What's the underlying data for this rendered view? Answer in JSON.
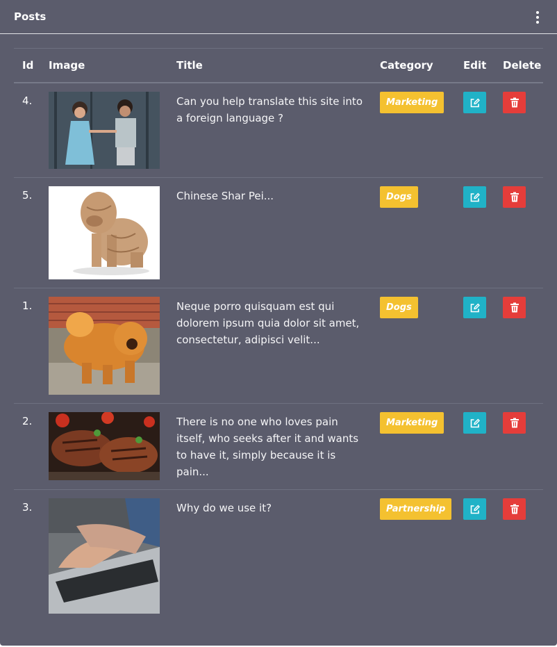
{
  "card": {
    "title": "Posts"
  },
  "table": {
    "headers": {
      "id": "Id",
      "image": "Image",
      "title": "Title",
      "category": "Category",
      "edit": "Edit",
      "delete": "Delete"
    },
    "rows": [
      {
        "id": "4.",
        "image": "photo-children-holding-hands",
        "title": "Can you help translate this site into a foreign language ?",
        "category": "Marketing"
      },
      {
        "id": "5.",
        "image": "photo-shar-pei-dog",
        "title": "Chinese Shar Pei...",
        "category": "Dogs"
      },
      {
        "id": "1.",
        "image": "photo-chow-chow-dog",
        "title": "Neque porro quisquam est qui dolorem ipsum quia dolor sit amet, consectetur, adipisci velit...",
        "category": "Dogs"
      },
      {
        "id": "2.",
        "image": "photo-grilled-steaks",
        "title": "There is no one who loves pain itself, who seeks after it and wants to have it, simply because it is pain...",
        "category": "Marketing"
      },
      {
        "id": "3.",
        "image": "photo-hands-typing-laptop",
        "title": "Why do we use it?",
        "category": "Partnership"
      }
    ]
  },
  "icons": {
    "edit": "pencil-square-icon",
    "delete": "trash-icon",
    "menu": "vertical-dots-icon"
  },
  "colors": {
    "card_bg": "#5b5c6c",
    "badge": "#f4c130",
    "edit_button": "#20b2c7",
    "delete_button": "#e53d3a"
  }
}
